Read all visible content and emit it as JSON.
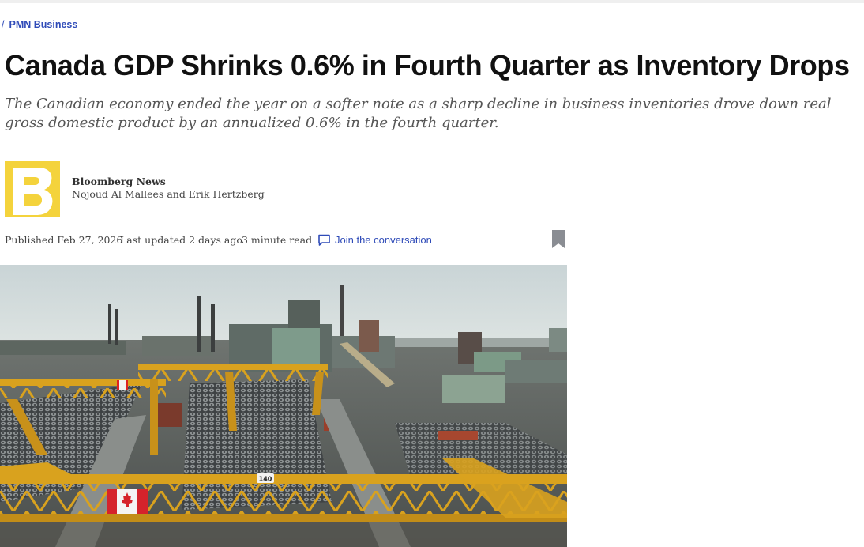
{
  "breadcrumb": {
    "separator": "/",
    "section": "PMN Business"
  },
  "article": {
    "headline": "Canada GDP Shrinks 0.6% in Fourth Quarter as Inventory Drops",
    "dek": "The Canadian economy ended the year on a softer note as a sharp decline in business inventories drove down real gross domestic product by an annualized 0.6% in the fourth quarter."
  },
  "byline": {
    "logo_letter": "B",
    "source": "Bloomberg News",
    "authors": "Nojoud Al Mallees and Erik Hertzberg"
  },
  "meta": {
    "published": "Published Feb 27, 2026",
    "updated": "Last updated 2 days ago",
    "read_time": "3 minute read",
    "join_label": "Join the conversation"
  },
  "hero": {
    "crane_number": "140"
  },
  "colors": {
    "link_blue": "#2f4bb8",
    "logo_yellow": "#f4d33c",
    "crane_yellow": "#d9a21e",
    "bookmark_gray": "#8a8d93"
  },
  "icons": {
    "comment": "speech-bubble-icon",
    "bookmark": "bookmark-icon"
  }
}
